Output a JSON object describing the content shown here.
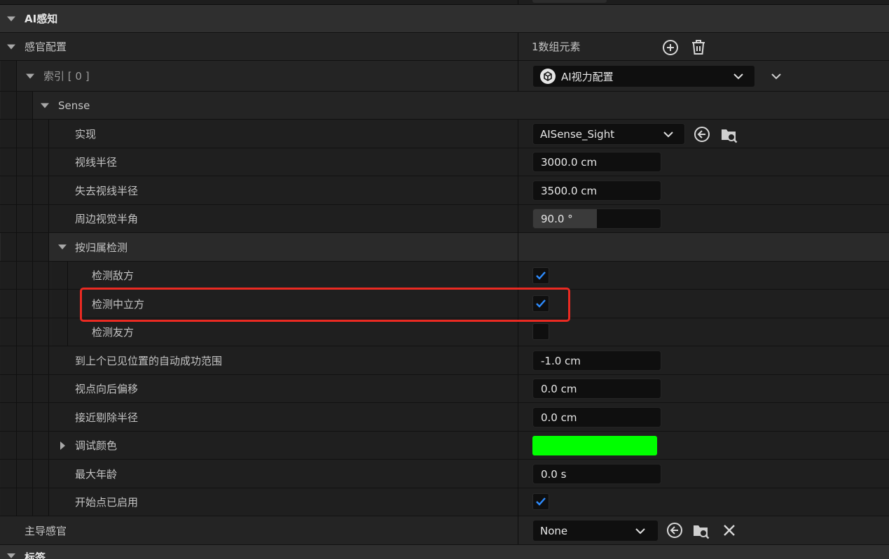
{
  "sections": {
    "ai_perception": "AI感知",
    "sense_config": "感官配置",
    "sense_config_value": "1数组元素",
    "index": "索引 [ 0 ]",
    "index_value": "AI视力配置",
    "sense": "Sense",
    "group": "按归属检测",
    "tags": "标签"
  },
  "props": {
    "implementation": {
      "label": "实现",
      "value": "AISense_Sight"
    },
    "sight_radius": {
      "label": "视线半径",
      "value": "3000.0 cm"
    },
    "lose_sight_radius": {
      "label": "失去视线半径",
      "value": "3500.0 cm"
    },
    "peripheral_angle": {
      "label": "周边视觉半角",
      "value": "90.0 °",
      "fill_fraction": 0.5
    },
    "detect_enemies": {
      "label": "检测敌方",
      "checked": true
    },
    "detect_neutrals": {
      "label": "检测中立方",
      "checked": true
    },
    "detect_friendlies": {
      "label": "检测友方",
      "checked": false
    },
    "auto_success_range": {
      "label": "到上个已见位置的自动成功范围",
      "value": "-1.0 cm"
    },
    "point_of_view_offset": {
      "label": "视点向后偏移",
      "value": "0.0 cm"
    },
    "nearby_clear_radius": {
      "label": "接近剔除半径",
      "value": "0.0 cm"
    },
    "debug_color": {
      "label": "调试颜色",
      "color": "#00ff00"
    },
    "max_age": {
      "label": "最大年龄",
      "value": "0.0 s"
    },
    "starts_enabled": {
      "label": "开始点已启用",
      "checked": true
    },
    "dominant_sense": {
      "label": "主导感官",
      "value": "None"
    }
  },
  "colors": {
    "accent_check": "#2e8cff",
    "highlight_box": "#ea2a22",
    "debug_color": "#00ff00"
  },
  "icons": [
    "add-element-icon",
    "delete-all-icon",
    "cube-asset-icon",
    "chevron-down-icon",
    "use-selected-icon",
    "browse-asset-icon",
    "clear-icon",
    "checkmark-icon"
  ]
}
